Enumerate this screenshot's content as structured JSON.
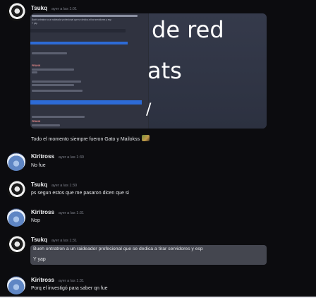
{
  "messages": [
    {
      "author": "Tsukq",
      "time": "ayer a las 1:01",
      "avatar": "tsukq"
    },
    {
      "caption": "Todo el momento siempre fueron Gato y Mailokss"
    },
    {
      "author": "Kiritross",
      "time": "ayer a las 1:30",
      "text": "No fue",
      "avatar": "kiritross"
    },
    {
      "author": "Tsukq",
      "time": "ayer a las 1:30",
      "text": "ps segun estos que me pasaron dicen que si",
      "avatar": "tsukq"
    },
    {
      "author": "Kiritross",
      "time": "ayer a las 1:31",
      "text": "Nop",
      "avatar": "kiritross"
    },
    {
      "author": "Tsukq",
      "time": "ayer a las 1:31",
      "text": "Bueh ontratron a un raideador profecional que se dedica a tirar servidores y esp",
      "text2": "Y yap",
      "avatar": "tsukq"
    },
    {
      "author": "Kiritross",
      "time": "ayer a las 1:31",
      "text": "Porq el investigó para saber qn fue",
      "avatar": "kiritross"
    }
  ],
  "attachment": {
    "left_texts": [
      "Bueh ontratron a un raideador profecional que se dedica a tirar servidores y esp",
      "Y yap",
      "FRANK"
    ],
    "right_line1": "de red",
    "right_line2": "ats"
  },
  "colors": {
    "accent_blue": "#2d6bd6",
    "background": "#0c0c0f",
    "highlight": "#44464f"
  }
}
